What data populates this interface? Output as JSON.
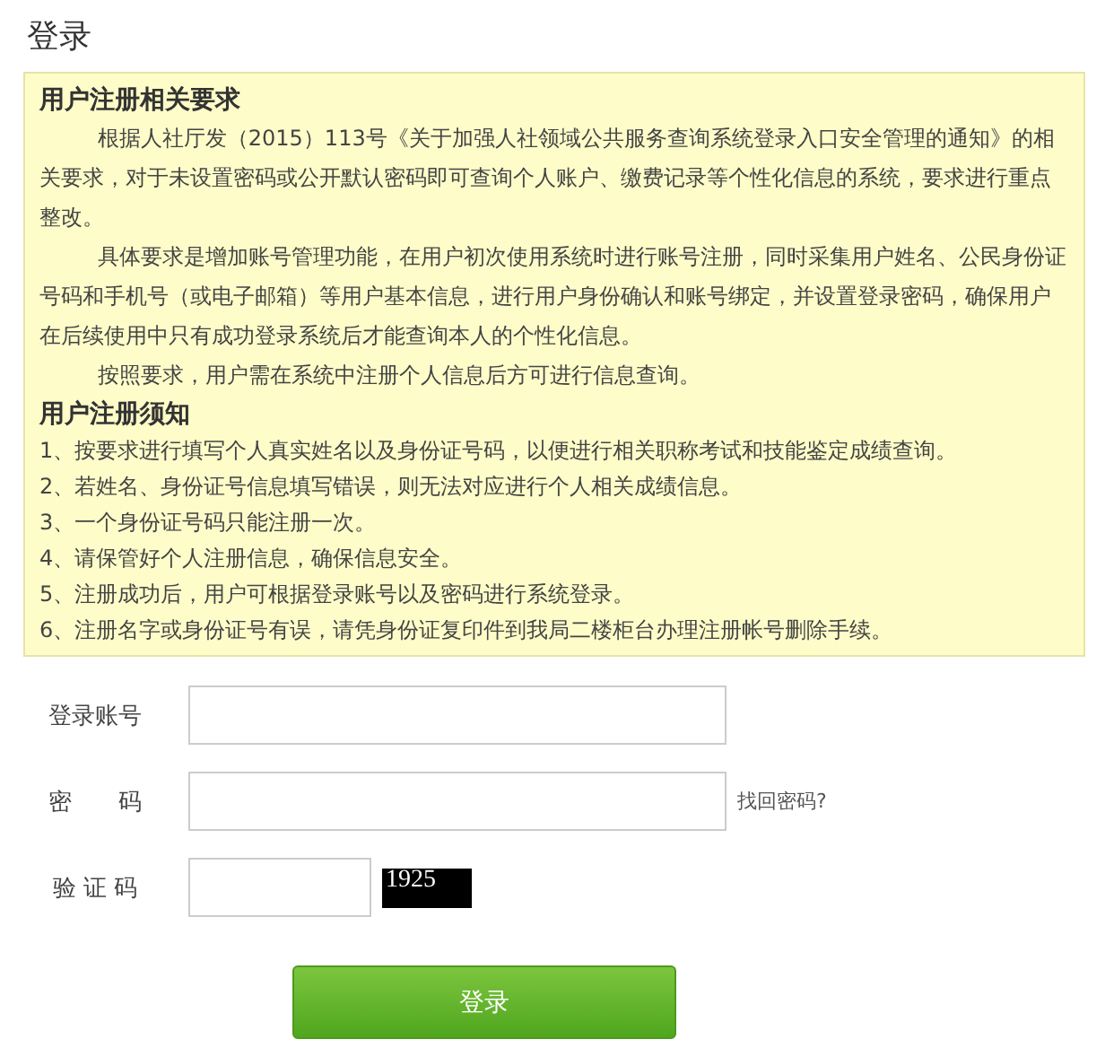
{
  "title": "登录",
  "notice": {
    "sections": [
      {
        "heading": "用户注册相关要求",
        "kind": "paragraphs",
        "items": [
          "根据人社厅发（2015）113号《关于加强人社领域公共服务查询系统登录入口安全管理的通知》的相关要求，对于未设置密码或公开默认密码即可查询个人账户、缴费记录等个性化信息的系统，要求进行重点整改。",
          "具体要求是增加账号管理功能，在用户初次使用系统时进行账号注册，同时采集用户姓名、公民身份证号码和手机号（或电子邮箱）等用户基本信息，进行用户身份确认和账号绑定，并设置登录密码，确保用户在后续使用中只有成功登录系统后才能查询本人的个性化信息。",
          "按照要求，用户需在系统中注册个人信息后方可进行信息查询。"
        ]
      },
      {
        "heading": "用户注册须知",
        "kind": "list",
        "items": [
          "1、按要求进行填写个人真实姓名以及身份证号码，以便进行相关职称考试和技能鉴定成绩查询。",
          "2、若姓名、身份证号信息填写错误，则无法对应进行个人相关成绩信息。",
          "3、一个身份证号码只能注册一次。",
          "4、请保管好个人注册信息，确保信息安全。",
          "5、注册成功后，用户可根据登录账号以及密码进行系统登录。",
          "6、注册名字或身份证号有误，请凭身份证复印件到我局二楼柜台办理注册帐号删除手续。"
        ]
      }
    ]
  },
  "form": {
    "fields": [
      {
        "label": "登录账号",
        "kind": "text"
      },
      {
        "label": "密　　码",
        "kind": "password",
        "link": "找回密码?"
      },
      {
        "label": "验 证 码",
        "kind": "captcha",
        "captcha": "1925"
      }
    ],
    "submit": "登录"
  }
}
